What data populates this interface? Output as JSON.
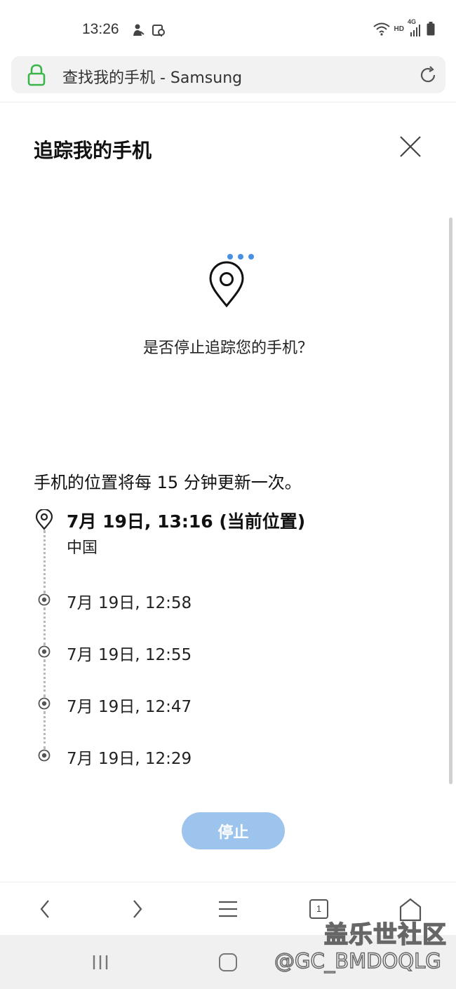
{
  "status_bar": {
    "time": "13:26",
    "hd_label": "HD",
    "network_label": "4G",
    "icons": [
      "person-notification-icon",
      "location-notification-icon",
      "wifi-icon",
      "signal-icon",
      "battery-icon"
    ]
  },
  "browser": {
    "page_title": "查找我的手机 - Samsung",
    "icons": [
      "lock-icon",
      "reload-icon"
    ]
  },
  "dialog": {
    "title": "追踪我的手机",
    "question": "是否停止追踪您的手机？",
    "update_note": "手机的位置将每 15 分钟更新一次。",
    "current": {
      "time": "7月 19日, 13:16 (当前位置)",
      "place": "中国"
    },
    "history": [
      "7月 19日, 12:58",
      "7月 19日, 12:55",
      "7月 19日, 12:47",
      "7月 19日, 12:29"
    ],
    "stop_label": "停止",
    "colors": {
      "accent": "#4a90e2",
      "stop_button": "#9dc4ec"
    }
  },
  "bottom_nav": {
    "tab_count": "1",
    "icons": [
      "back-icon",
      "forward-icon",
      "menu-icon",
      "tabs-icon",
      "home-icon"
    ]
  },
  "watermark": {
    "line1": "盖乐世社区",
    "line2": "@GC_BMDOQLG"
  }
}
